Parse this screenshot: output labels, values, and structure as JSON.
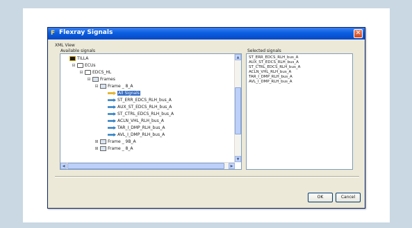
{
  "window": {
    "title": "Flexray Signals",
    "close_glyph": "✕"
  },
  "group_label": "XML View",
  "available_label": "Available signals",
  "selected_label": "Selected signals",
  "tree": [
    {
      "label": "TILLA",
      "depth": 0,
      "expander": "",
      "icon": "root-icon"
    },
    {
      "label": "ECUs",
      "depth": 1,
      "expander": "⊟",
      "icon": "network-icon"
    },
    {
      "label": "EDCS_HL",
      "depth": 2,
      "expander": "⊟",
      "icon": "network-icon"
    },
    {
      "label": "Frames",
      "depth": 3,
      "expander": "⊟",
      "icon": "frames-icon"
    },
    {
      "label": "Frame _ 8_A",
      "depth": 4,
      "expander": "⊟",
      "icon": "frame-icon"
    },
    {
      "label": "All Signals",
      "depth": 5,
      "expander": "",
      "icon": "all-signals-icon",
      "selected": true
    },
    {
      "label": "ST_ERR_EDCS_RLH_bus_A",
      "depth": 5,
      "expander": "",
      "icon": "signal-icon"
    },
    {
      "label": "AUX_ST_EDCS_RLH_bus_A",
      "depth": 5,
      "expander": "",
      "icon": "signal-icon"
    },
    {
      "label": "ST_CTRL_EDCS_RLH_bus_A",
      "depth": 5,
      "expander": "",
      "icon": "signal-icon"
    },
    {
      "label": "ACLN_VHL_RLH_bus_A",
      "depth": 5,
      "expander": "",
      "icon": "signal-icon"
    },
    {
      "label": "TAR_I_DMP_RLH_bus_A",
      "depth": 5,
      "expander": "",
      "icon": "signal-icon"
    },
    {
      "label": "AVL_I_DMP_RLH_bus_A",
      "depth": 5,
      "expander": "",
      "icon": "signal-icon"
    },
    {
      "label": "Frame _ 9B_A",
      "depth": 4,
      "expander": "⊞",
      "icon": "frame-icon"
    },
    {
      "label": "Frame _ 8_A",
      "depth": 4,
      "expander": "⊞",
      "icon": "frame-icon"
    }
  ],
  "selected_signals": [
    "ST_ERR_EDCS_RLH_bus_A",
    "AUX_ST_EDCS_RLH_bus_A",
    "ST_CTRL_EDCS_RLH_bus_A",
    "ACLN_VHL_RLH_bus_A",
    "TAR_I_DMP_RLH_bus_A",
    "AVL_I_DMP_RLH_bus_A"
  ],
  "buttons": {
    "ok": "OK",
    "cancel": "Cancel"
  },
  "colors": {
    "titlebar": "#0a5ee0",
    "highlight": "#316ac5",
    "background": "#c9d8e2"
  }
}
